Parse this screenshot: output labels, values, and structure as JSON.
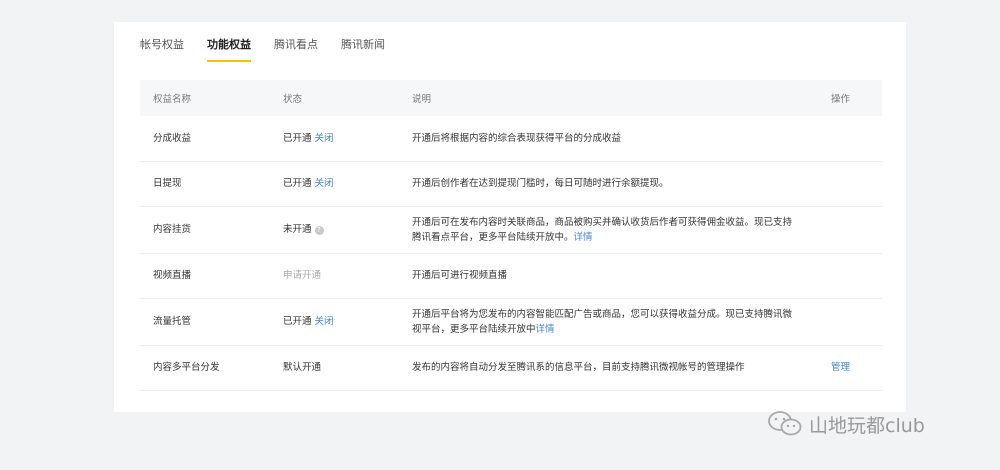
{
  "tabs": [
    {
      "label": "帐号权益",
      "active": false
    },
    {
      "label": "功能权益",
      "active": true
    },
    {
      "label": "腾讯看点",
      "active": false
    },
    {
      "label": "腾讯新闻",
      "active": false
    }
  ],
  "table": {
    "headers": {
      "name": "权益名称",
      "status": "状态",
      "desc": "说明",
      "action": "操作"
    },
    "rows": [
      {
        "name": "分成收益",
        "status": "已开通",
        "status_link": "关闭",
        "desc": "开通后将根据内容的综合表现获得平台的分成收益",
        "action": ""
      },
      {
        "name": "日提现",
        "status": "已开通",
        "status_link": "关闭",
        "desc": "开通后创作者在达到提现门槛时，每日可随时进行余额提现。",
        "action": ""
      },
      {
        "name": "内容挂货",
        "status": "未开通",
        "status_help": "?",
        "desc": "开通后可在发布内容时关联商品，商品被购买并确认收货后作者可获得佣金收益。现已支持腾讯看点平台，更多平台陆续开放中。",
        "desc_link": "详情",
        "action": ""
      },
      {
        "name": "视频直播",
        "status": "申请开通",
        "desc": "开通后可进行视频直播",
        "action": ""
      },
      {
        "name": "流量托管",
        "status": "已开通",
        "status_link": "关闭",
        "desc": "开通后平台将为您发布的内容智能匹配广告或商品，您可以获得收益分成。现已支持腾讯微视平台，更多平台陆续开放中",
        "desc_link": "详情",
        "action": ""
      },
      {
        "name": "内容多平台分发",
        "status": "默认开通",
        "desc": "发布的内容将自动分发至腾讯系的信息平台，目前支持腾讯微视帐号的管理操作",
        "action": "管理"
      }
    ]
  },
  "watermark": {
    "text": "山地玩都club",
    "icon": "wechat-icon"
  },
  "colors": {
    "accent_underline": "#f5c400",
    "link": "#3f86d6",
    "background": "#f2f3f5"
  }
}
